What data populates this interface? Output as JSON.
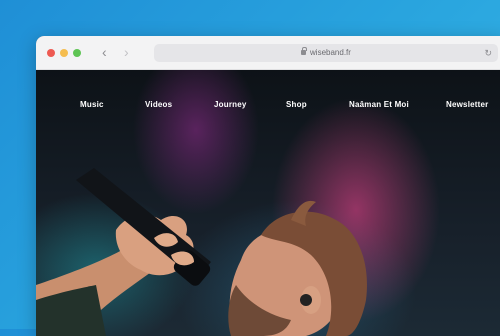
{
  "browser": {
    "url": "wiseband.fr"
  },
  "nav": {
    "items": [
      {
        "label": "Music"
      },
      {
        "label": "Videos"
      },
      {
        "label": "Journey"
      },
      {
        "label": "Shop"
      },
      {
        "label": "Naâman Et Moi"
      },
      {
        "label": "Newsletter"
      }
    ]
  },
  "icons": {
    "back": "chevron-left-icon",
    "forward": "chevron-right-icon",
    "lock": "lock-icon",
    "reload": "reload-icon"
  },
  "colors": {
    "background": "#2aa6df",
    "close": "#ee5a52",
    "minimize": "#f5bd4f",
    "maximize": "#5ec454"
  }
}
